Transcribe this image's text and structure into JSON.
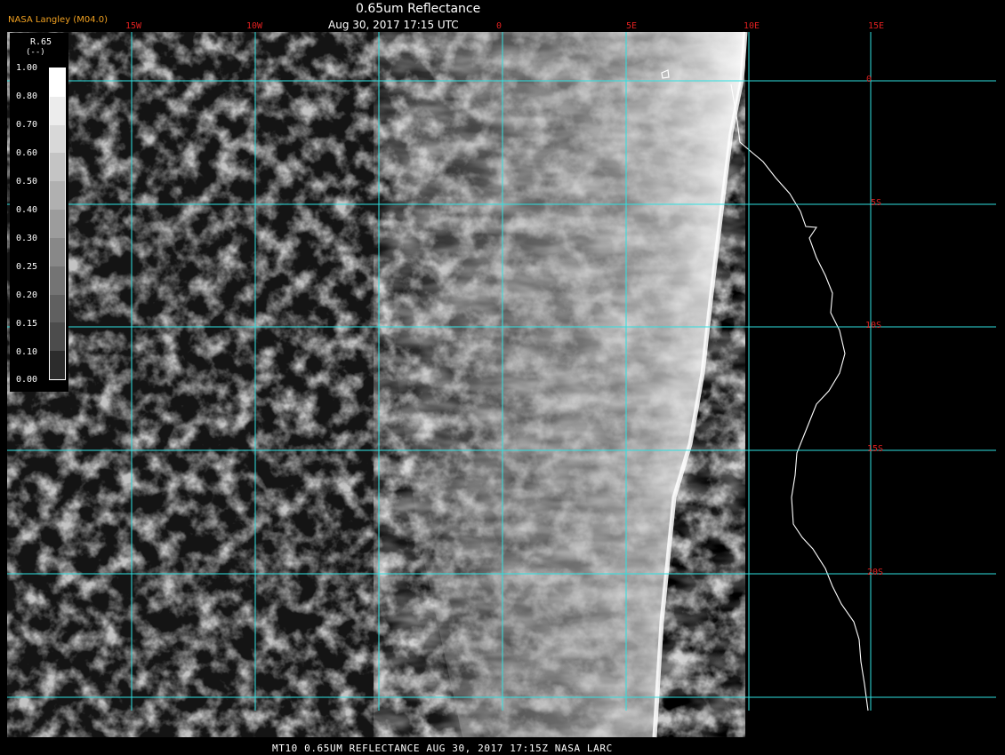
{
  "header": {
    "credit": "NASA Langley (M04.0)",
    "title": "0.65um Reflectance",
    "datetime": "Aug 30, 2017 17:15 UTC"
  },
  "footer": {
    "caption": "MT10  0.65UM REFLECTANCE   AUG 30, 2017 17:15Z   NASA LARC"
  },
  "legend": {
    "variable": "R.65",
    "unit": "(--)",
    "ticks": [
      "1.00",
      "0.80",
      "0.70",
      "0.60",
      "0.50",
      "0.40",
      "0.30",
      "0.25",
      "0.20",
      "0.15",
      "0.10",
      "0.00"
    ],
    "ramp": [
      "#ffffff",
      "#ececec",
      "#d8d8d8",
      "#c4c4c4",
      "#b0b0b0",
      "#9c9c9c",
      "#888888",
      "#747474",
      "#606060",
      "#4c4c4c",
      "#2c2c2c"
    ]
  },
  "map": {
    "lon_labels": [
      "15W",
      "10W",
      "0",
      "5E",
      "10E",
      "15E"
    ],
    "lat_labels": [
      "0",
      "5S",
      "10S",
      "15S",
      "20S"
    ],
    "gridline_color": "#2fe0e0",
    "label_color": "#e02020",
    "coastline_color": "#ffffff"
  }
}
